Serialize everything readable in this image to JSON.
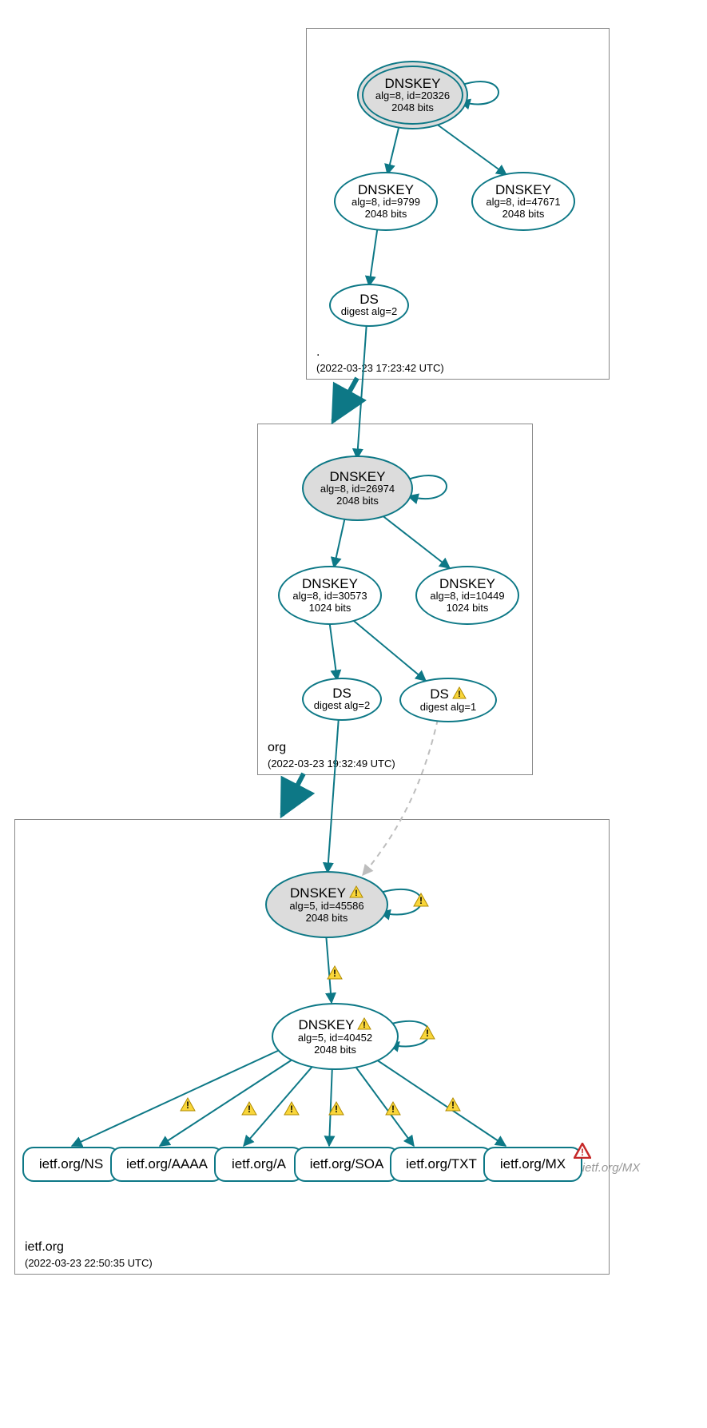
{
  "colors": {
    "stroke": "#0d7886",
    "gray_stroke": "#bdbdbd",
    "warn_fill": "#f9d63a",
    "warn_stroke": "#b08b00",
    "err_stroke": "#c62828",
    "box_stroke": "#888888"
  },
  "zones": {
    "root": {
      "label": ".",
      "timestamp": "(2022-03-23 17:23:42 UTC)"
    },
    "org": {
      "label": "org",
      "timestamp": "(2022-03-23 19:32:49 UTC)"
    },
    "ietf": {
      "label": "ietf.org",
      "timestamp": "(2022-03-23 22:50:35 UTC)"
    }
  },
  "nodes": {
    "root_ksk": {
      "title": "DNSKEY",
      "line2": "alg=8, id=20326",
      "line3": "2048 bits"
    },
    "root_zsk1": {
      "title": "DNSKEY",
      "line2": "alg=8, id=9799",
      "line3": "2048 bits"
    },
    "root_zsk2": {
      "title": "DNSKEY",
      "line2": "alg=8, id=47671",
      "line3": "2048 bits"
    },
    "root_ds": {
      "title": "DS",
      "line2": "digest alg=2"
    },
    "org_ksk": {
      "title": "DNSKEY",
      "line2": "alg=8, id=26974",
      "line3": "2048 bits"
    },
    "org_zsk1": {
      "title": "DNSKEY",
      "line2": "alg=8, id=30573",
      "line3": "1024 bits"
    },
    "org_zsk2": {
      "title": "DNSKEY",
      "line2": "alg=8, id=10449",
      "line3": "1024 bits"
    },
    "org_ds1": {
      "title": "DS",
      "line2": "digest alg=2"
    },
    "org_ds2": {
      "title": "DS",
      "line2": "digest alg=1",
      "warn": true
    },
    "ietf_ksk": {
      "title": "DNSKEY",
      "line2": "alg=5, id=45586",
      "line3": "2048 bits",
      "warn": true
    },
    "ietf_zsk": {
      "title": "DNSKEY",
      "line2": "alg=5, id=40452",
      "line3": "2048 bits",
      "warn": true
    },
    "rr_ns": {
      "label": "ietf.org/NS"
    },
    "rr_aaaa": {
      "label": "ietf.org/AAAA"
    },
    "rr_a": {
      "label": "ietf.org/A"
    },
    "rr_soa": {
      "label": "ietf.org/SOA"
    },
    "rr_txt": {
      "label": "ietf.org/TXT"
    },
    "rr_mx": {
      "label": "ietf.org/MX"
    },
    "rr_mx2": {
      "label": "ietf.org/MX"
    }
  }
}
